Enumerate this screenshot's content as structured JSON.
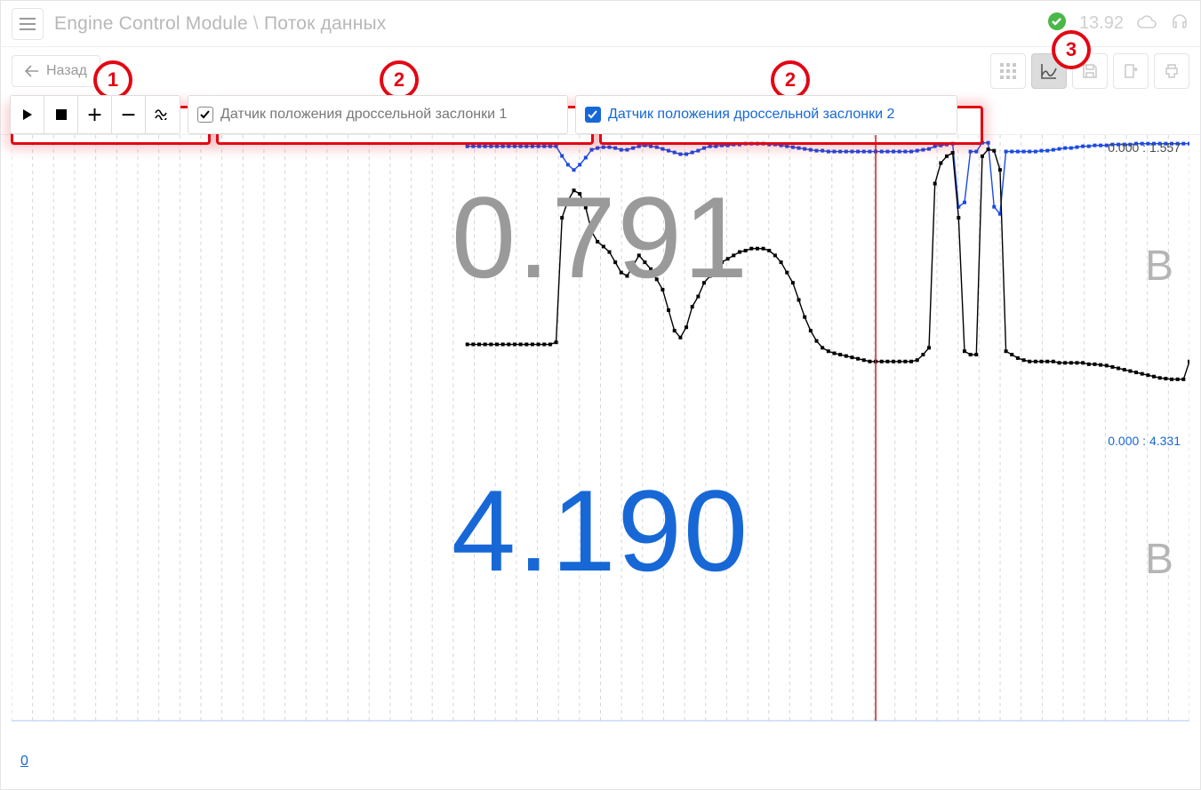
{
  "header": {
    "breadcrumb_main": "Engine Control Module",
    "breadcrumb_sep": "\\",
    "breadcrumb_sub": "Поток данных",
    "voltage": "13.92"
  },
  "secondrow": {
    "back_label": "Назад"
  },
  "controls": {
    "sensors": [
      {
        "label": "Датчик положения дроссельной заслонки 1",
        "selected": false
      },
      {
        "label": "Датчик положения дроссельной заслонки 2",
        "selected": true
      }
    ]
  },
  "callouts": {
    "num1": "1",
    "num2a": "2",
    "num2b": "2",
    "num3": "3"
  },
  "chart": {
    "value_sensor1": "0.791",
    "value_sensor2": "4.190",
    "unit1": "В",
    "unit2": "В",
    "range1": "0.000 : 1.557",
    "range2": "0.000 : 4.331",
    "zero_label": "0"
  },
  "chart_data": {
    "type": "line",
    "x_count": 200,
    "cursor_x": 146,
    "series": [
      {
        "name": "Датчик положения дроссельной заслонки 1",
        "color": "#000000",
        "ylim": [
          0,
          4.331
        ],
        "current": 4.19,
        "start_index": 77,
        "values": [
          1.35,
          1.35,
          1.35,
          1.35,
          1.35,
          1.35,
          1.35,
          1.35,
          1.35,
          1.35,
          1.35,
          1.35,
          1.35,
          1.35,
          1.35,
          1.38,
          3.2,
          3.45,
          3.6,
          3.55,
          3.35,
          3.0,
          2.85,
          2.78,
          2.7,
          2.55,
          2.4,
          2.35,
          2.5,
          2.65,
          2.55,
          2.45,
          2.3,
          2.15,
          1.85,
          1.55,
          1.45,
          1.6,
          1.9,
          2.05,
          2.25,
          2.35,
          2.45,
          2.55,
          2.6,
          2.65,
          2.7,
          2.72,
          2.75,
          2.75,
          2.75,
          2.72,
          2.65,
          2.55,
          2.4,
          2.25,
          2.0,
          1.75,
          1.55,
          1.4,
          1.3,
          1.25,
          1.22,
          1.2,
          1.18,
          1.16,
          1.14,
          1.12,
          1.1,
          1.1,
          1.1,
          1.1,
          1.1,
          1.1,
          1.1,
          1.1,
          1.12,
          1.2,
          1.3,
          3.7,
          4.0,
          4.1,
          4.15,
          3.2,
          1.25,
          1.2,
          1.2,
          4.1,
          4.2,
          4.18,
          3.9,
          1.25,
          1.2,
          1.15,
          1.12,
          1.1,
          1.1,
          1.1,
          1.1,
          1.1,
          1.08,
          1.08,
          1.08,
          1.08,
          1.08,
          1.06,
          1.06,
          1.05,
          1.04,
          1.02,
          1.0,
          0.98,
          0.96,
          0.94,
          0.92,
          0.9,
          0.88,
          0.86,
          0.85,
          0.84,
          0.84,
          0.84,
          1.1
        ]
      },
      {
        "name": "Датчик положения дроссельной заслонки 2",
        "color": "#1b4ae0",
        "ylim": [
          0,
          1.557
        ],
        "current": 0.791,
        "start_index": 77,
        "values": [
          1.49,
          1.49,
          1.49,
          1.49,
          1.49,
          1.49,
          1.49,
          1.49,
          1.49,
          1.49,
          1.49,
          1.49,
          1.49,
          1.49,
          1.49,
          1.49,
          1.38,
          1.28,
          1.22,
          1.28,
          1.36,
          1.45,
          1.47,
          1.48,
          1.48,
          1.47,
          1.45,
          1.45,
          1.47,
          1.49,
          1.5,
          1.49,
          1.48,
          1.46,
          1.44,
          1.42,
          1.4,
          1.4,
          1.42,
          1.44,
          1.47,
          1.49,
          1.49,
          1.5,
          1.5,
          1.51,
          1.51,
          1.52,
          1.52,
          1.52,
          1.52,
          1.51,
          1.51,
          1.5,
          1.49,
          1.48,
          1.47,
          1.46,
          1.45,
          1.44,
          1.44,
          1.43,
          1.43,
          1.43,
          1.43,
          1.43,
          1.43,
          1.43,
          1.43,
          1.43,
          1.43,
          1.43,
          1.43,
          1.43,
          1.43,
          1.43,
          1.44,
          1.45,
          1.46,
          1.49,
          1.5,
          1.51,
          1.52,
          0.8,
          0.85,
          1.43,
          1.43,
          1.53,
          1.53,
          0.8,
          0.72,
          1.43,
          1.43,
          1.43,
          1.43,
          1.43,
          1.43,
          1.44,
          1.44,
          1.45,
          1.46,
          1.47,
          1.47,
          1.48,
          1.49,
          1.49,
          1.5,
          1.5,
          1.5,
          1.51,
          1.51,
          1.51,
          1.51,
          1.52,
          1.52,
          1.52,
          1.52,
          1.52,
          1.52,
          1.52,
          1.52,
          1.52,
          1.52
        ]
      }
    ]
  }
}
